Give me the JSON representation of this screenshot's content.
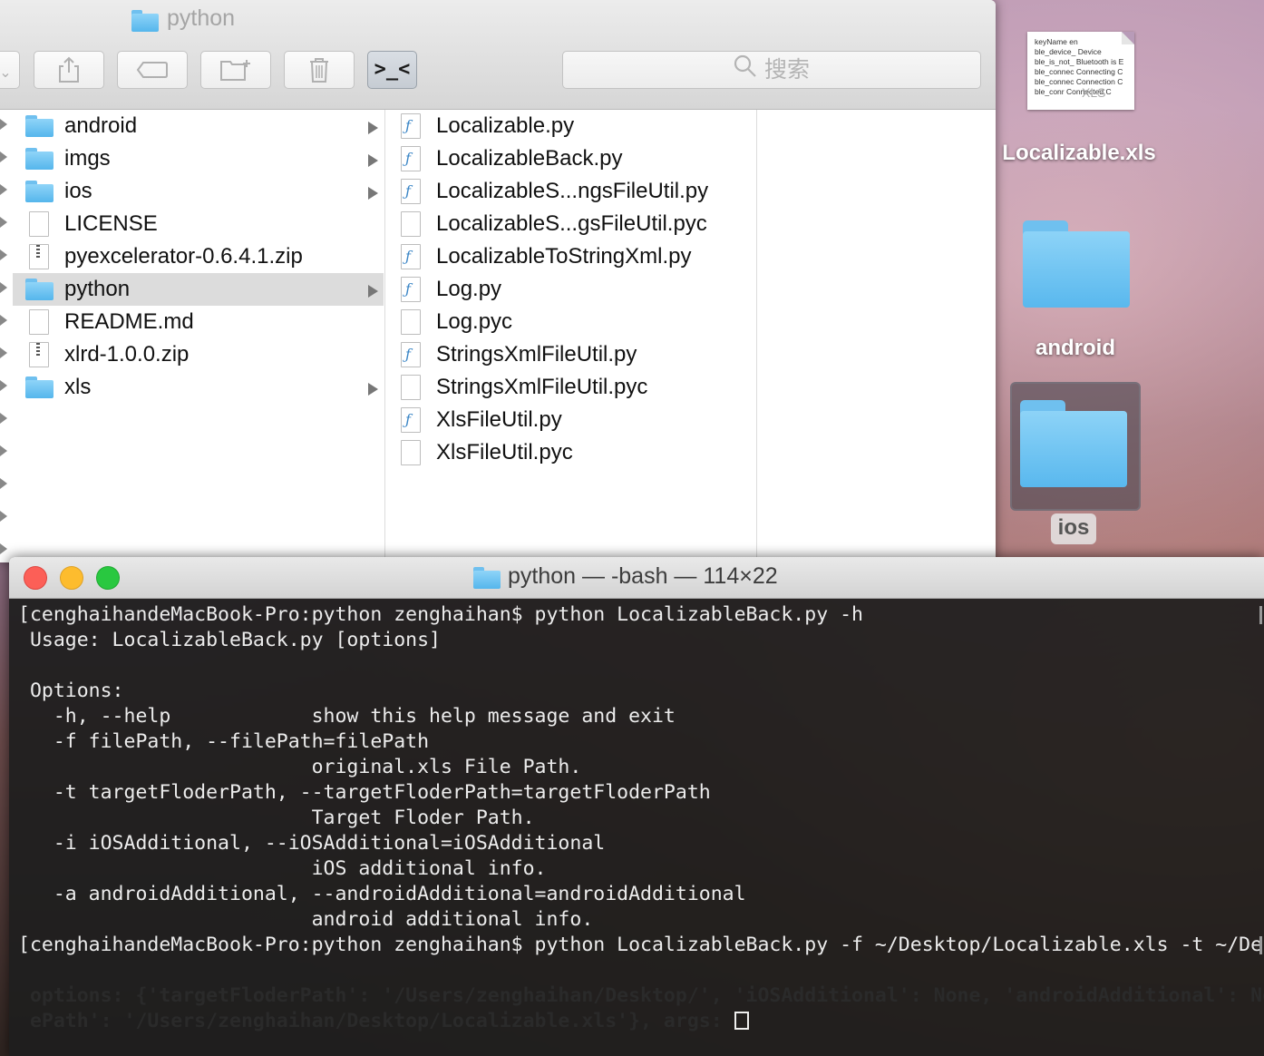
{
  "finder": {
    "title": "python",
    "search_placeholder": "搜索",
    "toolbar": {
      "share_icon": "share-icon",
      "tag_icon": "tag-icon",
      "new_folder_icon": "new-folder-icon",
      "trash_icon": "trash-icon",
      "terminal_glyph": ">_<"
    },
    "column1": [
      {
        "name": "android",
        "type": "folder",
        "has_children": true
      },
      {
        "name": "imgs",
        "type": "folder",
        "has_children": true
      },
      {
        "name": "ios",
        "type": "folder",
        "has_children": true
      },
      {
        "name": "LICENSE",
        "type": "file"
      },
      {
        "name": "pyexcelerator-0.6.4.1.zip",
        "type": "zip"
      },
      {
        "name": "python",
        "type": "folder",
        "has_children": true,
        "selected": true
      },
      {
        "name": "README.md",
        "type": "file"
      },
      {
        "name": "xlrd-1.0.0.zip",
        "type": "zip"
      },
      {
        "name": "xls",
        "type": "folder",
        "has_children": true
      }
    ],
    "column2": [
      {
        "name": "Localizable.py",
        "type": "py"
      },
      {
        "name": "LocalizableBack.py",
        "type": "py"
      },
      {
        "name": "LocalizableS...ngsFileUtil.py",
        "type": "py"
      },
      {
        "name": "LocalizableS...gsFileUtil.pyc",
        "type": "file"
      },
      {
        "name": "LocalizableToStringXml.py",
        "type": "py"
      },
      {
        "name": "Log.py",
        "type": "py"
      },
      {
        "name": "Log.pyc",
        "type": "file"
      },
      {
        "name": "StringsXmlFileUtil.py",
        "type": "py"
      },
      {
        "name": "StringsXmlFileUtil.pyc",
        "type": "file"
      },
      {
        "name": "XlsFileUtil.py",
        "type": "py"
      },
      {
        "name": "XlsFileUtil.pyc",
        "type": "file"
      }
    ]
  },
  "desktop": {
    "xls_file_label": "Localizable.xls",
    "xls_preview_lines": [
      "keyName     en",
      "ble_device_  Device",
      "ble_is_not_  Bluetooth is E",
      "ble_connec  Connecting C",
      "ble_connec  Connection C",
      "ble_conr     Connected  C"
    ],
    "xls_watermark": "XLS",
    "android_label": "android",
    "ios_label": "ios"
  },
  "terminal": {
    "title": "python — -bash — 114×22",
    "lines": [
      "[cenghaihandeMacBook-Pro:python zenghaihan$ python LocalizableBack.py -h",
      " Usage: LocalizableBack.py [options]",
      "",
      " Options:",
      "   -h, --help            show this help message and exit",
      "   -f filePath, --filePath=filePath",
      "                         original.xls File Path.",
      "   -t targetFloderPath, --targetFloderPath=targetFloderPath",
      "                         Target Floder Path.",
      "   -i iOSAdditional, --iOSAdditional=iOSAdditional",
      "                         iOS additional info.",
      "   -a androidAdditional, --androidAdditional=androidAdditional",
      "                         android additional info.",
      "[cenghaihandeMacBook-Pro:python zenghaihan$ python LocalizableBack.py -f ~/Desktop/Localizable.xls -t ~/Desktop/",
      "",
      " options: {'targetFloderPath': '/Users/zenghaihan/Desktop/', 'iOSAdditional': None, 'androidAdditional': None, 'fil",
      " ePath': '/Users/zenghaihan/Desktop/Localizable.xls'}, args: "
    ]
  }
}
